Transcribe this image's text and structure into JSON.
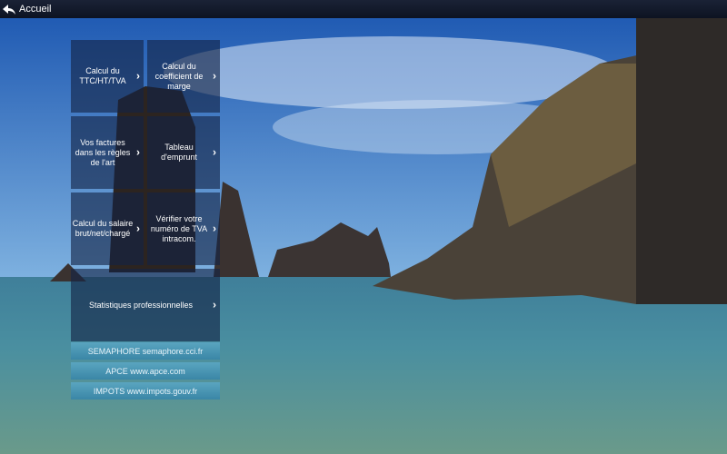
{
  "header": {
    "back_label": "Accueil"
  },
  "tiles": [
    {
      "label": "Calcul du TTC/HT/TVA"
    },
    {
      "label": "Calcul du coefficient de marge"
    },
    {
      "label": "Vos factures dans les règles de l'art"
    },
    {
      "label": "Tableau d'emprunt"
    },
    {
      "label": "Calcul du salaire brut/net/chargé"
    },
    {
      "label": "Vérifier votre numéro de TVA intracom."
    },
    {
      "label": "Statistiques professionnelles"
    }
  ],
  "links": [
    {
      "label": "SEMAPHORE semaphore.cci.fr"
    },
    {
      "label": "APCE www.apce.com"
    },
    {
      "label": "IMPOTS www.impots.gouv.fr"
    }
  ],
  "chevron": "›"
}
